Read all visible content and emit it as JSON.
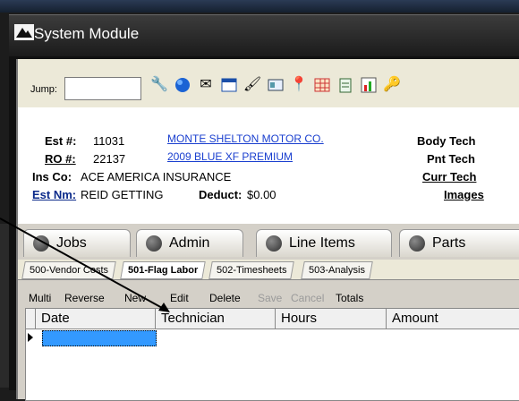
{
  "window": {
    "title": "System Module"
  },
  "toolbar": {
    "jump_label": "Jump:",
    "jump_value": "",
    "icons": [
      "wrench-icon",
      "globe-icon",
      "envelope-icon",
      "calendar-icon",
      "brush-icon",
      "card-icon",
      "pin-icon",
      "grid-icon",
      "clipboard-icon",
      "chart-icon",
      "key-icon"
    ]
  },
  "estimate": {
    "est_label": "Est #:",
    "est_value": "11031",
    "ro_label": "RO #:",
    "ro_value": "22137",
    "ins_label": "Ins Co:",
    "ins_value": "ACE AMERICA INSURANCE",
    "estnm_label": "Est Nm:",
    "estnm_value": "REID GETTING",
    "deduct_label": "Deduct:",
    "deduct_value": "$0.00",
    "customer_link": "MONTE SHELTON MOTOR CO.",
    "vehicle_link": "2009 BLUE XF PREMIUM",
    "body_tech_label": "Body Tech",
    "pnt_tech_label": "Pnt Tech",
    "curr_tech_label": "Curr Tech",
    "images_label": "Images"
  },
  "tabs": [
    "Jobs",
    "Admin",
    "Line Items",
    "Parts"
  ],
  "subtabs": [
    "500-Vendor Costs",
    "501-Flag Labor",
    "502-Timesheets",
    "503-Analysis"
  ],
  "actions": {
    "multi": "Multi",
    "reverse": "Reverse",
    "new": "New",
    "edit": "Edit",
    "delete": "Delete",
    "save": "Save",
    "cancel": "Cancel",
    "totals": "Totals"
  },
  "grid": {
    "columns": [
      "Date",
      "Technician",
      "Hours",
      "Amount"
    ]
  },
  "colors": {
    "selection": "#3399ff",
    "link": "#1a3fcf"
  }
}
